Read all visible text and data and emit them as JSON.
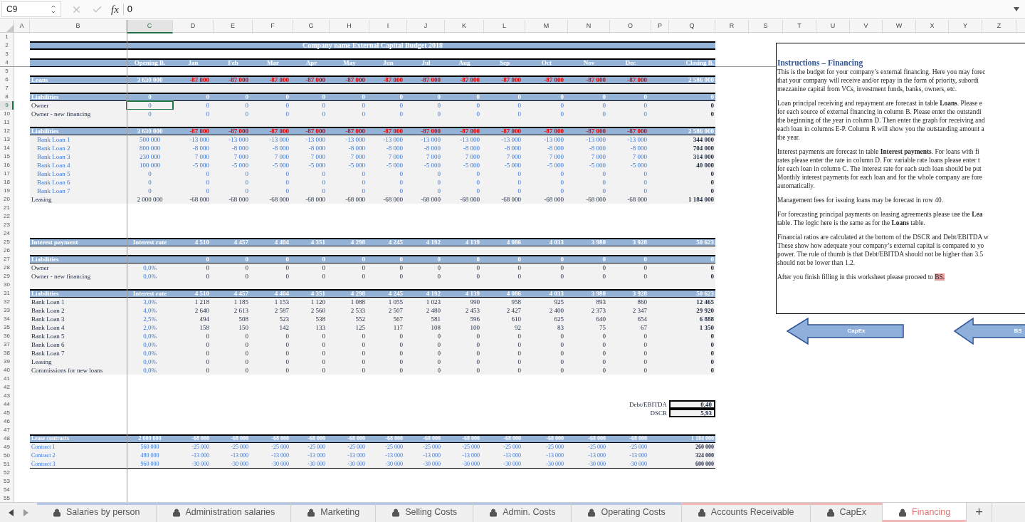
{
  "formula_bar": {
    "cell": "C9",
    "function_label": "fx",
    "value": "0"
  },
  "columns": [
    {
      "label": "A",
      "selected": false
    },
    {
      "label": "B",
      "selected": false
    },
    {
      "label": "C",
      "selected": true
    },
    {
      "label": "D",
      "selected": false
    },
    {
      "label": "E",
      "selected": false
    },
    {
      "label": "F",
      "selected": false
    },
    {
      "label": "G",
      "selected": false
    },
    {
      "label": "H",
      "selected": false
    },
    {
      "label": "I",
      "selected": false
    },
    {
      "label": "J",
      "selected": false
    },
    {
      "label": "K",
      "selected": false
    },
    {
      "label": "L",
      "selected": false
    },
    {
      "label": "M",
      "selected": false
    },
    {
      "label": "N",
      "selected": false
    },
    {
      "label": "O",
      "selected": false
    },
    {
      "label": "P",
      "selected": false
    },
    {
      "label": "Q",
      "selected": false
    },
    {
      "label": "R",
      "selected": false
    },
    {
      "label": "S",
      "selected": false
    },
    {
      "label": "T",
      "selected": false
    },
    {
      "label": "U",
      "selected": false
    },
    {
      "label": "V",
      "selected": false
    },
    {
      "label": "W",
      "selected": false
    },
    {
      "label": "X",
      "selected": false
    },
    {
      "label": "Y",
      "selected": false
    },
    {
      "label": "Z",
      "selected": false
    }
  ],
  "rows": [
    {
      "n": "1",
      "kind": "blank",
      "selected": false
    },
    {
      "n": "2",
      "kind": "title",
      "selected": false,
      "title": "Company name External Capital Budget 2018"
    },
    {
      "n": "3",
      "kind": "blank",
      "selected": false
    },
    {
      "n": "4",
      "kind": "header",
      "selected": false,
      "values": [
        "Opening B.",
        "Jan",
        "Feb",
        "Mar",
        "Apr",
        "May",
        "Jun",
        "Jul",
        "Aug",
        "Sep",
        "Oct",
        "Nov",
        "Dec"
      ],
      "closing": "Closing B."
    },
    {
      "n": "5",
      "kind": "blank",
      "selected": false
    },
    {
      "n": "6",
      "kind": "band",
      "selected": false,
      "alert": true,
      "label": "Loans",
      "values": [
        "3 630 000",
        "-87 000",
        "-87 000",
        "-87 000",
        "-87 000",
        "-87 000",
        "-87 000",
        "-87 000",
        "-87 000",
        "-87 000",
        "-87 000",
        "-87 000",
        "-87 000"
      ],
      "closing": "2 586 000"
    },
    {
      "n": "7",
      "kind": "gap",
      "selected": false
    },
    {
      "n": "8",
      "kind": "band",
      "selected": false,
      "alert": false,
      "label": "Liabilities",
      "values": [
        "0",
        "0",
        "0",
        "0",
        "0",
        "0",
        "0",
        "0",
        "0",
        "0",
        "0",
        "0",
        "0"
      ],
      "closing": "0"
    },
    {
      "n": "9",
      "kind": "item",
      "selected": true,
      "label_input": false,
      "values_input": true,
      "label": "Owner",
      "values": [
        "0",
        "0",
        "0",
        "0",
        "0",
        "0",
        "0",
        "0",
        "0",
        "0",
        "0",
        "0",
        "0"
      ],
      "closing": "0"
    },
    {
      "n": "10",
      "kind": "item",
      "selected": false,
      "label_input": false,
      "values_input": true,
      "label": "Owner - new financing",
      "values": [
        "0",
        "0",
        "0",
        "0",
        "0",
        "0",
        "0",
        "0",
        "0",
        "0",
        "0",
        "0",
        "0"
      ],
      "closing": "0"
    },
    {
      "n": "11",
      "kind": "gap",
      "selected": false
    },
    {
      "n": "12",
      "kind": "band",
      "selected": false,
      "alert": true,
      "label": "Liabilities",
      "values": [
        "3 630 000",
        "-87 000",
        "-87 000",
        "-87 000",
        "-87 000",
        "-87 000",
        "-87 000",
        "-87 000",
        "-87 000",
        "-87 000",
        "-87 000",
        "-87 000",
        "-87 000"
      ],
      "closing": "2 586 000"
    },
    {
      "n": "13",
      "kind": "item",
      "selected": false,
      "label_input": true,
      "values_input": true,
      "label": "Bank Loan 1",
      "values": [
        "500 000",
        "-13 000",
        "-13 000",
        "-13 000",
        "-13 000",
        "-13 000",
        "-13 000",
        "-13 000",
        "-13 000",
        "-13 000",
        "-13 000",
        "-13 000",
        "-13 000"
      ],
      "closing": "344 000"
    },
    {
      "n": "14",
      "kind": "item",
      "selected": false,
      "label_input": true,
      "values_input": true,
      "label": "Bank Loan 2",
      "values": [
        "800 000",
        "-8 000",
        "-8 000",
        "-8 000",
        "-8 000",
        "-8 000",
        "-8 000",
        "-8 000",
        "-8 000",
        "-8 000",
        "-8 000",
        "-8 000",
        "-8 000"
      ],
      "closing": "704 000"
    },
    {
      "n": "15",
      "kind": "item",
      "selected": false,
      "label_input": true,
      "values_input": true,
      "label": "Bank Loan 3",
      "values": [
        "230 000",
        "7 000",
        "7 000",
        "7 000",
        "7 000",
        "7 000",
        "7 000",
        "7 000",
        "7 000",
        "7 000",
        "7 000",
        "7 000",
        "7 000"
      ],
      "closing": "314 000"
    },
    {
      "n": "16",
      "kind": "item",
      "selected": false,
      "label_input": true,
      "values_input": true,
      "label": "Bank Loan 4",
      "values": [
        "100 000",
        "-5 000",
        "-5 000",
        "-5 000",
        "-5 000",
        "-5 000",
        "-5 000",
        "-5 000",
        "-5 000",
        "-5 000",
        "-5 000",
        "-5 000",
        "-5 000"
      ],
      "closing": "40 000"
    },
    {
      "n": "17",
      "kind": "item",
      "selected": false,
      "label_input": true,
      "values_input": true,
      "label": "Bank Loan 5",
      "values": [
        "0",
        "0",
        "0",
        "0",
        "0",
        "0",
        "0",
        "0",
        "0",
        "0",
        "0",
        "0",
        "0"
      ],
      "closing": "0"
    },
    {
      "n": "18",
      "kind": "item",
      "selected": false,
      "label_input": true,
      "values_input": true,
      "label": "Bank Loan 6",
      "values": [
        "0",
        "0",
        "0",
        "0",
        "0",
        "0",
        "0",
        "0",
        "0",
        "0",
        "0",
        "0",
        "0"
      ],
      "closing": "0"
    },
    {
      "n": "19",
      "kind": "item",
      "selected": false,
      "label_input": true,
      "values_input": true,
      "label": "Bank Loan 7",
      "values": [
        "0",
        "0",
        "0",
        "0",
        "0",
        "0",
        "0",
        "0",
        "0",
        "0",
        "0",
        "0",
        "0"
      ],
      "closing": "0"
    },
    {
      "n": "20",
      "kind": "item",
      "selected": false,
      "label_input": false,
      "values_input": false,
      "label": "Leasing",
      "values": [
        "2 000 000",
        "-68 000",
        "-68 000",
        "-68 000",
        "-68 000",
        "-68 000",
        "-68 000",
        "-68 000",
        "-68 000",
        "-68 000",
        "-68 000",
        "-68 000",
        "-68 000"
      ],
      "closing": "1 184 000"
    },
    {
      "n": "21",
      "kind": "blank",
      "selected": false
    },
    {
      "n": "22",
      "kind": "blank",
      "selected": false
    },
    {
      "n": "23",
      "kind": "blank",
      "selected": false
    },
    {
      "n": "24",
      "kind": "blank",
      "selected": false
    },
    {
      "n": "25",
      "kind": "band",
      "selected": false,
      "alert": false,
      "label": "Interest payment",
      "values": [
        "Interest rate",
        "4 510",
        "4 457",
        "4 404",
        "4 351",
        "4 298",
        "4 245",
        "4 192",
        "4 139",
        "4 086",
        "4 033",
        "3 980",
        "3 928"
      ],
      "closing": "50 623"
    },
    {
      "n": "26",
      "kind": "gap",
      "selected": false
    },
    {
      "n": "27",
      "kind": "band",
      "selected": false,
      "alert": false,
      "label": "Liabilities",
      "values": [
        "0",
        "0",
        "0",
        "0",
        "0",
        "0",
        "0",
        "0",
        "0",
        "0",
        "0",
        "0"
      ],
      "closing": "0"
    },
    {
      "n": "28",
      "kind": "rate_item",
      "selected": false,
      "label": "Owner",
      "values": [
        "0,0%",
        "0",
        "0",
        "0",
        "0",
        "0",
        "0",
        "0",
        "0",
        "0",
        "0",
        "0",
        "0"
      ],
      "closing": "0"
    },
    {
      "n": "29",
      "kind": "rate_item",
      "selected": false,
      "label": "Owner - new financing",
      "values": [
        "0,0%",
        "0",
        "0",
        "0",
        "0",
        "0",
        "0",
        "0",
        "0",
        "0",
        "0",
        "0",
        "0"
      ],
      "closing": "0"
    },
    {
      "n": "30",
      "kind": "gap",
      "selected": false
    },
    {
      "n": "31",
      "kind": "band",
      "selected": false,
      "alert": false,
      "label": "Liabilities",
      "values": [
        "Interest rate",
        "4 510",
        "4 457",
        "4 404",
        "4 351",
        "4 298",
        "4 245",
        "4 192",
        "4 139",
        "4 086",
        "4 033",
        "3 980",
        "3 928"
      ],
      "closing": "50 623"
    },
    {
      "n": "32",
      "kind": "rate_item",
      "selected": false,
      "label": "Bank Loan 1",
      "values": [
        "3,0%",
        "1 218",
        "1 185",
        "1 153",
        "1 120",
        "1 088",
        "1 055",
        "1 023",
        "990",
        "958",
        "925",
        "893",
        "860"
      ],
      "closing": "12 465"
    },
    {
      "n": "33",
      "kind": "rate_item",
      "selected": false,
      "label": "Bank Loan 2",
      "values": [
        "4,0%",
        "2 640",
        "2 613",
        "2 587",
        "2 560",
        "2 533",
        "2 507",
        "2 480",
        "2 453",
        "2 427",
        "2 400",
        "2 373",
        "2 347"
      ],
      "closing": "29 920"
    },
    {
      "n": "34",
      "kind": "rate_item",
      "selected": false,
      "label": "Bank Loan 3",
      "values": [
        "2,5%",
        "494",
        "508",
        "523",
        "538",
        "552",
        "567",
        "581",
        "596",
        "610",
        "625",
        "640",
        "654"
      ],
      "closing": "6 888"
    },
    {
      "n": "35",
      "kind": "rate_item",
      "selected": false,
      "label": "Bank Loan 4",
      "values": [
        "2,0%",
        "158",
        "150",
        "142",
        "133",
        "125",
        "117",
        "108",
        "100",
        "92",
        "83",
        "75",
        "67"
      ],
      "closing": "1 350"
    },
    {
      "n": "36",
      "kind": "rate_item",
      "selected": false,
      "label": "Bank Loan 5",
      "values": [
        "0,0%",
        "0",
        "0",
        "0",
        "0",
        "0",
        "0",
        "0",
        "0",
        "0",
        "0",
        "0",
        "0"
      ],
      "closing": "0"
    },
    {
      "n": "37",
      "kind": "rate_item",
      "selected": false,
      "label": "Bank Loan 6",
      "values": [
        "0,0%",
        "0",
        "0",
        "0",
        "0",
        "0",
        "0",
        "0",
        "0",
        "0",
        "0",
        "0",
        "0"
      ],
      "closing": "0"
    },
    {
      "n": "38",
      "kind": "rate_item",
      "selected": false,
      "label": "Bank Loan 7",
      "values": [
        "0,0%",
        "0",
        "0",
        "0",
        "0",
        "0",
        "0",
        "0",
        "0",
        "0",
        "0",
        "0",
        "0"
      ],
      "closing": "0"
    },
    {
      "n": "39",
      "kind": "rate_item",
      "selected": false,
      "label": "Leasing",
      "values": [
        "0,0%",
        "0",
        "0",
        "0",
        "0",
        "0",
        "0",
        "0",
        "0",
        "0",
        "0",
        "0",
        "0"
      ],
      "closing": "0"
    },
    {
      "n": "40",
      "kind": "rate_item",
      "selected": false,
      "label": "Commissions for new loans",
      "values": [
        "0,0%",
        "0",
        "0",
        "0",
        "0",
        "0",
        "0",
        "0",
        "0",
        "0",
        "0",
        "0",
        "0"
      ],
      "closing": "0"
    },
    {
      "n": "41",
      "kind": "blank",
      "selected": false
    },
    {
      "n": "42",
      "kind": "blank",
      "selected": false
    },
    {
      "n": "43",
      "kind": "blank",
      "selected": false
    },
    {
      "n": "44",
      "kind": "ratio",
      "selected": false,
      "label": "Debt/EBITDA",
      "closing": "0,40"
    },
    {
      "n": "45",
      "kind": "ratio",
      "selected": false,
      "label": "DSCR",
      "closing": "5,93"
    },
    {
      "n": "46",
      "kind": "blank",
      "selected": false
    },
    {
      "n": "47",
      "kind": "blank",
      "selected": false
    },
    {
      "n": "48",
      "kind": "lease_band",
      "selected": false,
      "label": "Lease contracts",
      "values": [
        "2 000 000",
        "-68 000",
        "-68 000",
        "-68 000",
        "-68 000",
        "-68 000",
        "-68 000",
        "-68 000",
        "-68 000",
        "-68 000",
        "-68 000",
        "-68 000",
        "-68 000"
      ],
      "closing": "1 184 000"
    },
    {
      "n": "49",
      "kind": "lease_item",
      "selected": false,
      "label": "Contract 1",
      "values": [
        "560 000",
        "-25 000",
        "-25 000",
        "-25 000",
        "-25 000",
        "-25 000",
        "-25 000",
        "-25 000",
        "-25 000",
        "-25 000",
        "-25 000",
        "-25 000",
        "-25 000"
      ],
      "closing": "260 000"
    },
    {
      "n": "50",
      "kind": "lease_item",
      "selected": false,
      "label": "Contract 2",
      "values": [
        "480 000",
        "-13 000",
        "-13 000",
        "-13 000",
        "-13 000",
        "-13 000",
        "-13 000",
        "-13 000",
        "-13 000",
        "-13 000",
        "-13 000",
        "-13 000",
        "-13 000"
      ],
      "closing": "324 000"
    },
    {
      "n": "51",
      "kind": "lease_item",
      "selected": false,
      "label": "Contract 3",
      "values": [
        "960 000",
        "-30 000",
        "-30 000",
        "-30 000",
        "-30 000",
        "-30 000",
        "-30 000",
        "-30 000",
        "-30 000",
        "-30 000",
        "-30 000",
        "-30 000",
        "-30 000"
      ],
      "closing": "600 000"
    },
    {
      "n": "52",
      "kind": "blank",
      "selected": false
    },
    {
      "n": "53",
      "kind": "blank",
      "selected": false
    },
    {
      "n": "54",
      "kind": "blank",
      "selected": false
    },
    {
      "n": "55",
      "kind": "blank",
      "selected": false
    }
  ],
  "instructions": {
    "title": "Instructions – Financing",
    "paragraphs": [
      {
        "lines": [
          "This is the budget for your company’s external financing. Here you may forec",
          "that your company will receive and/or repay in the form of priority, subordi",
          "mezzanine capital from VCs, investment funds, banks, owners, etc."
        ]
      },
      {
        "lines": [
          "Loan principal receiving and repayment are forecast in table **Loans**. Please e",
          "for each source of external financing in column B. Please enter the outstandi",
          "the beginning of the year in column D. Then enter the graph for receiving and",
          "each loan in columns E-P. Column R will show you the outstanding amount a",
          "the year."
        ]
      },
      {
        "lines": [
          "Interest payments are forecast in table **Interest payments**. For loans with fi",
          "rates please enter the rate in column D. For variable rate loans please enter t",
          "for each loan in column C. The interest rate for each such loan should be put",
          "Monthly interest payments for each loan and for the whole company are fore",
          "automatically."
        ]
      },
      {
        "lines": [
          "Management fees for issuing loans may be forecast in row 40."
        ]
      },
      {
        "lines": [
          "For forecasting principal payments on leasing agreements please use the **Lea**",
          "table. The logic here is the same as for the **Loans** table."
        ]
      },
      {
        "lines": [
          "Financial ratios are calculated at the bottom of the DSCR and Debt/EBITDA w",
          "These show how adequate your company’s external capital is compared to yo",
          "power. The rule of thumb is that Debt/EBITDA should not be higher than 3.5",
          "should not be lower than 1.2."
        ]
      }
    ],
    "closing": {
      "text": "After you finish filling in this worksheet please proceed to ",
      "link": "BS."
    }
  },
  "arrows": [
    "CapEx",
    "BS"
  ],
  "tabs": [
    {
      "label": "Salaries by person",
      "selected": false,
      "color": "#b4c7e7"
    },
    {
      "label": "Administration salaries",
      "selected": false,
      "color": "#b4c7e7"
    },
    {
      "label": "Marketing",
      "selected": false,
      "color": "#b4c7e7"
    },
    {
      "label": "Selling Costs",
      "selected": false,
      "color": "#b4c7e7"
    },
    {
      "label": "Admin. Costs",
      "selected": false,
      "color": "#b4c7e7"
    },
    {
      "label": "Operating Costs",
      "selected": false,
      "color": "#b4c7e7"
    },
    {
      "label": "Accounts Receivable",
      "selected": false,
      "color": "#f2b8b8"
    },
    {
      "label": "CapEx",
      "selected": false,
      "color": "#f2b8b8"
    },
    {
      "label": "Financing",
      "selected": true,
      "color": "#f2b8b8"
    }
  ],
  "add_tab": "+"
}
